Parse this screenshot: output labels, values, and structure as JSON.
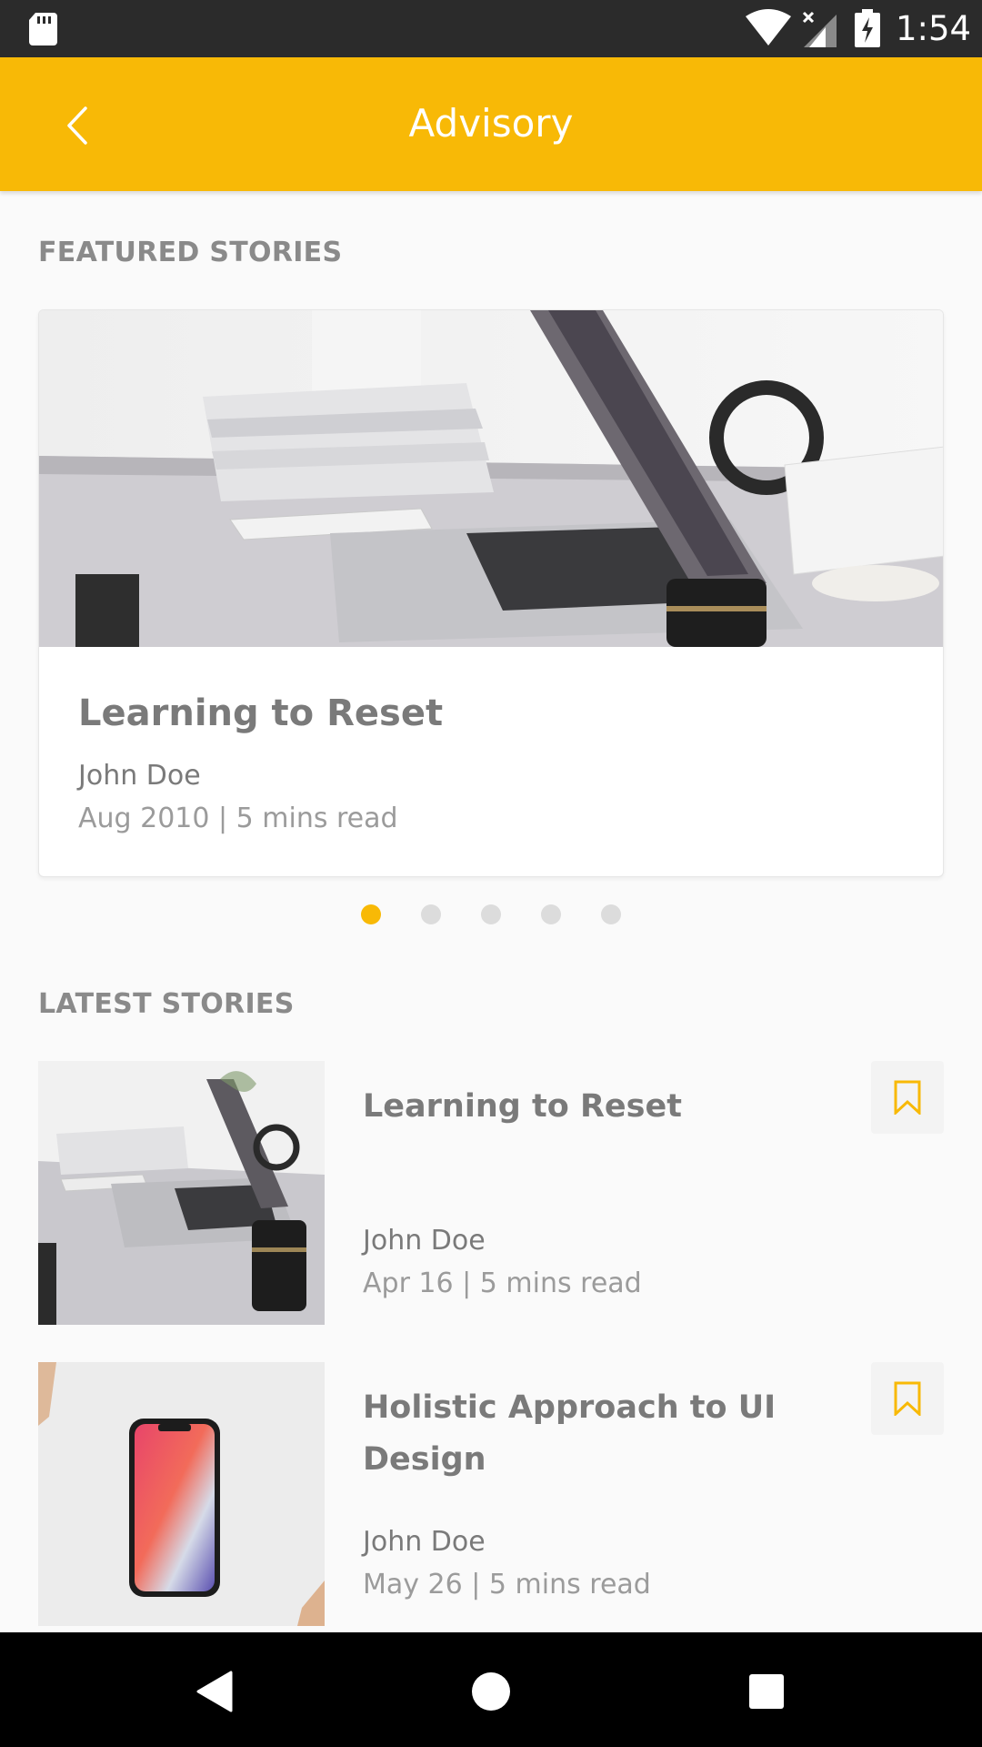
{
  "status_bar": {
    "time": "1:54",
    "icons": [
      "sd-card-icon",
      "wifi-icon",
      "cell-signal-icon",
      "battery-charging-icon"
    ]
  },
  "app_bar": {
    "title": "Advisory",
    "back_icon": "chevron-left-icon"
  },
  "featured": {
    "section_label": "FEATURED STORIES",
    "card": {
      "title": "Learning to Reset",
      "author": "John Doe",
      "meta": "Aug 2010 | 5 mins read",
      "image": "laptop-desk-photo"
    },
    "pager": {
      "count": 5,
      "active_index": 0
    }
  },
  "latest": {
    "section_label": "LATEST STORIES",
    "items": [
      {
        "title": "Learning to Reset",
        "author": "John Doe",
        "meta": "Apr 16 | 5 mins read",
        "image": "laptop-desk-photo",
        "bookmark_icon": "bookmark-icon"
      },
      {
        "title": "Holistic Approach to UI Design",
        "author": "John Doe",
        "meta": "May 26 | 5 mins read",
        "image": "phone-photo",
        "bookmark_icon": "bookmark-icon"
      }
    ]
  },
  "nav_bar": {
    "buttons": [
      "back-triangle-icon",
      "home-circle-icon",
      "recents-square-icon"
    ]
  },
  "colors": {
    "accent": "#f8b906",
    "status_bar": "#2b2b2b",
    "text_primary": "#7a7a7a",
    "text_secondary": "#9b9b9b"
  }
}
